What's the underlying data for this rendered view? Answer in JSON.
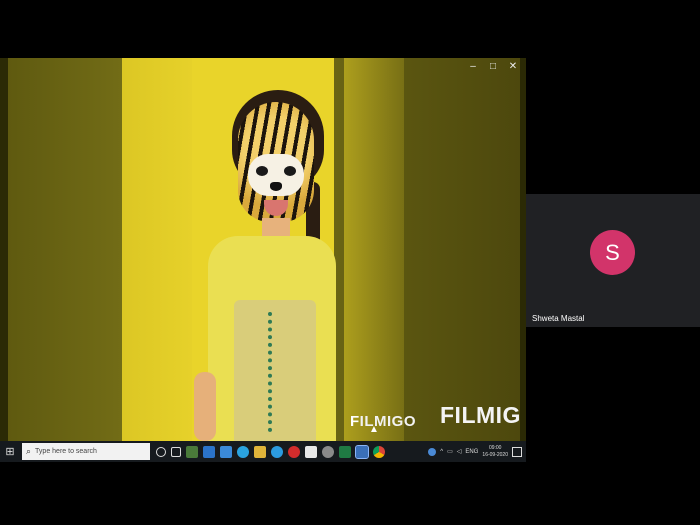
{
  "shared_screen": {
    "watermark_small": "FILMIGO",
    "watermark_large": "FILMIGO",
    "window_controls": [
      "–",
      "□",
      "✕"
    ]
  },
  "taskbar": {
    "search_placeholder": "Type here to search",
    "tray_language": "ENG",
    "clock_time": "09:00",
    "clock_date": "16-09-2020"
  },
  "participant": {
    "initial": "S",
    "name": "Shweta Mastal",
    "avatar_color": "#d2346a"
  },
  "colors": {
    "tile_background": "#202124",
    "taskbar_background": "#161a1e"
  }
}
